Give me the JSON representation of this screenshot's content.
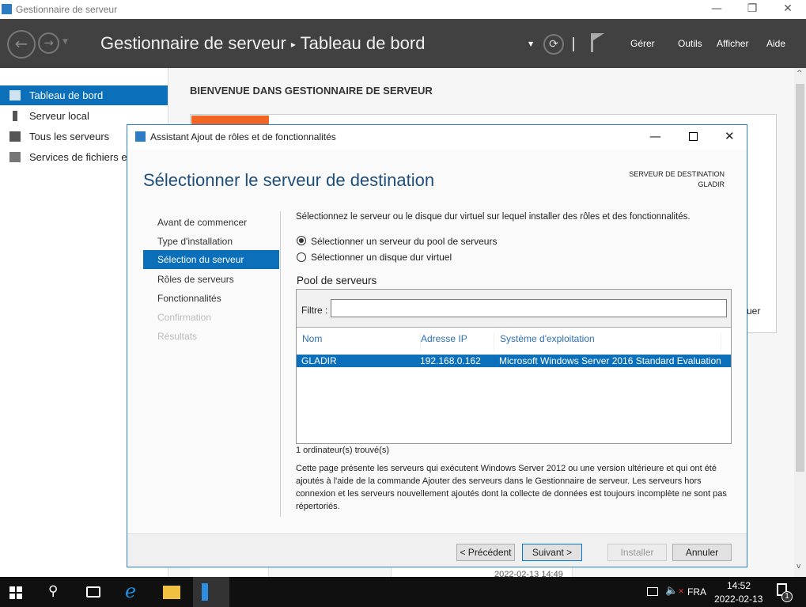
{
  "window": {
    "title": "Gestionnaire de serveur"
  },
  "header": {
    "app": "Gestionnaire de serveur",
    "separator": "▸",
    "page": "Tableau de bord",
    "menus": [
      "Gérer",
      "Outils",
      "Afficher",
      "Aide"
    ]
  },
  "sidebar": {
    "items": [
      {
        "label": "Tableau de bord",
        "selected": true
      },
      {
        "label": "Serveur local"
      },
      {
        "label": "Tous les serveurs"
      },
      {
        "label": "Services de fichiers et"
      }
    ]
  },
  "main": {
    "welcome": "BIENVENUE DANS GESTIONNAIRE DE SERVEUR",
    "partial_text": "uer",
    "partial_timestamp": "2022-02-13 14:49"
  },
  "dialog": {
    "title": "Assistant Ajout de rôles et de fonctionnalités",
    "heading": "Sélectionner le serveur de destination",
    "dest_label": "SERVEUR DE DESTINATION",
    "dest_value": "GLADIR",
    "steps": [
      {
        "label": "Avant de commencer"
      },
      {
        "label": "Type d'installation"
      },
      {
        "label": "Sélection du serveur",
        "selected": true
      },
      {
        "label": "Rôles de serveurs"
      },
      {
        "label": "Fonctionnalités"
      },
      {
        "label": "Confirmation",
        "disabled": true
      },
      {
        "label": "Résultats",
        "disabled": true
      }
    ],
    "instruction": "Sélectionnez le serveur ou le disque dur virtuel sur lequel installer des rôles et des fonctionnalités.",
    "radio_pool": "Sélectionner un serveur du pool de serveurs",
    "radio_vhd": "Sélectionner un disque dur virtuel",
    "pool_title": "Pool de serveurs",
    "filter_label": "Filtre :",
    "filter_value": "",
    "columns": [
      "Nom",
      "Adresse IP",
      "Système d'exploitation"
    ],
    "rows": [
      {
        "name": "GLADIR",
        "ip": "192.168.0.162",
        "os": "Microsoft Windows Server 2016 Standard Evaluation"
      }
    ],
    "count": "1 ordinateur(s) trouvé(s)",
    "note": "Cette page présente les serveurs qui exécutent Windows Server 2012 ou une version ultérieure et qui ont été ajoutés à l'aide de la commande Ajouter des serveurs dans le Gestionnaire de serveur. Les serveurs hors connexion et les serveurs nouvellement ajoutés dont la collecte de données est toujours incomplète ne sont pas répertoriés.",
    "buttons": {
      "prev": "< Précédent",
      "next": "Suivant >",
      "install": "Installer",
      "cancel": "Annuler"
    }
  },
  "taskbar": {
    "lang": "FRA",
    "time": "14:52",
    "date": "2022-02-13",
    "notif_count": "1"
  },
  "colors": {
    "accent": "#0b6fba",
    "header": "#414141",
    "orange": "#f26522"
  }
}
